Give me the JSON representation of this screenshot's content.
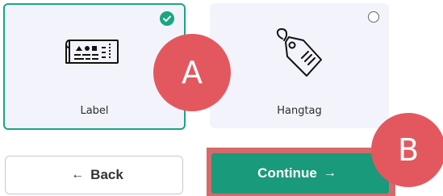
{
  "options": [
    {
      "label": "Label",
      "selected": true
    },
    {
      "label": "Hangtag",
      "selected": false
    }
  ],
  "icons": {
    "label_card": "label-sheet-icon",
    "hangtag_card": "hangtag-icon",
    "selected": "check-circle-icon",
    "unselected": "radio-empty-icon",
    "back": "arrow-left-icon",
    "continue": "arrow-right-icon"
  },
  "buttons": {
    "back_label": "Back",
    "back_arrow": "←",
    "continue_label": "Continue",
    "continue_arrow": "→"
  },
  "markers": {
    "a": "A",
    "b": "B"
  },
  "colors": {
    "selected_border": "#1ba682",
    "continue_bg": "#199a7a",
    "highlight": "#d66a6a",
    "marker": "#e3585f"
  }
}
